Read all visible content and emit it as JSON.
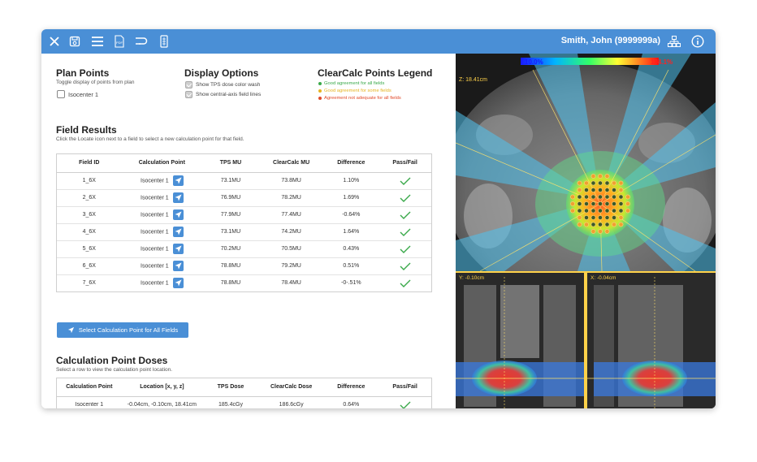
{
  "toolbar": {
    "icons": [
      "close-icon",
      "save-icon",
      "menu-icon",
      "pdf-icon",
      "link-icon",
      "document-icon"
    ],
    "pdf_label": "PDF",
    "user": "Smith, John (9999999a)",
    "right_icons": [
      "network-icon",
      "info-icon"
    ]
  },
  "plan_points": {
    "title": "Plan Points",
    "subtitle": "Toggle display of points from plan",
    "items": [
      {
        "label": "Isocenter 1",
        "checked": false
      }
    ]
  },
  "display_options": {
    "title": "Display Options",
    "items": [
      {
        "label": "Show TPS dose color wash",
        "checked": true
      },
      {
        "label": "Show central-axis field lines",
        "checked": true
      }
    ]
  },
  "legend": {
    "title": "ClearCalc Points Legend",
    "items": [
      {
        "label": "Good agreement for all fields",
        "color": "#3aa94a"
      },
      {
        "label": "Good agreement for some fields",
        "color": "#e6b422"
      },
      {
        "label": "Agreement not adequate for all fields",
        "color": "#e04a2a"
      }
    ]
  },
  "field_results": {
    "title": "Field Results",
    "subtitle": "Click the Locate icon next to a field to select a new calculation point for that field.",
    "columns": [
      "Field ID",
      "Calculation Point",
      "TPS MU",
      "ClearCalc MU",
      "Difference",
      "Pass/Fail"
    ],
    "rows": [
      {
        "field": "1_6X",
        "point": "Isocenter 1",
        "tps": "73.1MU",
        "cc": "73.8MU",
        "diff": "1.10%",
        "pass": true
      },
      {
        "field": "2_6X",
        "point": "Isocenter 1",
        "tps": "76.9MU",
        "cc": "78.2MU",
        "diff": "1.69%",
        "pass": true
      },
      {
        "field": "3_6X",
        "point": "Isocenter 1",
        "tps": "77.9MU",
        "cc": "77.4MU",
        "diff": "-0.64%",
        "pass": true
      },
      {
        "field": "4_6X",
        "point": "Isocenter 1",
        "tps": "73.1MU",
        "cc": "74.2MU",
        "diff": "1.64%",
        "pass": true
      },
      {
        "field": "5_6X",
        "point": "Isocenter 1",
        "tps": "70.2MU",
        "cc": "70.5MU",
        "diff": "0.43%",
        "pass": true
      },
      {
        "field": "6_6X",
        "point": "Isocenter 1",
        "tps": "78.8MU",
        "cc": "79.2MU",
        "diff": "0.51%",
        "pass": true
      },
      {
        "field": "7_6X",
        "point": "Isocenter 1",
        "tps": "78.8MU",
        "cc": "78.4MU",
        "diff": "-0-.51%",
        "pass": true
      }
    ],
    "select_all_label": "Select Calculation Point for All Fields"
  },
  "calc_point_doses": {
    "title": "Calculation Point Doses",
    "subtitle": "Select a row to view the calculation point location.",
    "columns": [
      "Calculation Point",
      "Location [x, y, z]",
      "TPS Dose",
      "ClearCalc Dose",
      "Difference",
      "Pass/Fail"
    ],
    "rows": [
      {
        "point": "Isocenter 1",
        "location": "-0.04cm, -0.10cm, 18.41cm",
        "tps": "185.4cGy",
        "cc": "186.6cGy",
        "diff": "0.64%",
        "pass": true
      }
    ]
  },
  "viewer": {
    "colorbar_min": "10.0%",
    "colorbar_max": "104.1%",
    "axial_label": "Z: 18.41cm",
    "coronal_label": "Y: -0.10cm",
    "sagittal_label": "X: -0.04cm"
  },
  "colors": {
    "accent": "#4a8fd6",
    "pass": "#3aa94a"
  }
}
